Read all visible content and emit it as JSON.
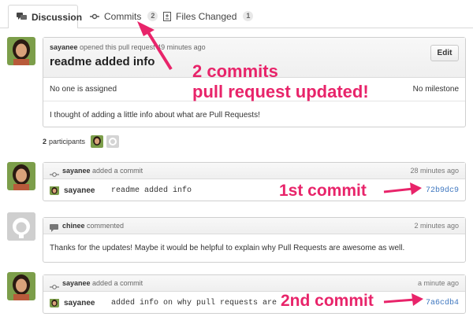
{
  "tabs": [
    {
      "label": "Discussion"
    },
    {
      "label": "Commits",
      "count": "2"
    },
    {
      "label": "Files Changed",
      "count": "1"
    }
  ],
  "pr": {
    "author": "sayanee",
    "meta_rest": "opened this pull request 49 minutes ago",
    "title": "readme added info",
    "edit_label": "Edit",
    "assignee": "No one is assigned",
    "milestone": "No milestone",
    "body": "I thought of adding a little info about what are Pull Requests!"
  },
  "participants": {
    "count": "2",
    "label": "participants"
  },
  "events": [
    {
      "user": "sayanee",
      "action": "added a commit",
      "time": "28 minutes ago",
      "commit_author": "sayanee",
      "commit_msg": "readme added info",
      "sha": "72b9dc9"
    },
    {
      "user": "chinee",
      "action": "commented",
      "time": "2 minutes ago",
      "body": "Thanks for the updates! Maybe it would be helpful to explain why Pull Requests are awesome as well."
    },
    {
      "user": "sayanee",
      "action": "added a commit",
      "time": "a minute ago",
      "commit_author": "sayanee",
      "commit_msg": "added info on why pull requests are awesome",
      "sha": "7a6cdb4"
    }
  ],
  "annotations": {
    "line1": "2 commits",
    "line2": "pull request updated!",
    "first": "1st commit",
    "second": "2nd commit"
  },
  "colors": {
    "accent_pink": "#e8246a",
    "link_blue": "#4078c0"
  }
}
